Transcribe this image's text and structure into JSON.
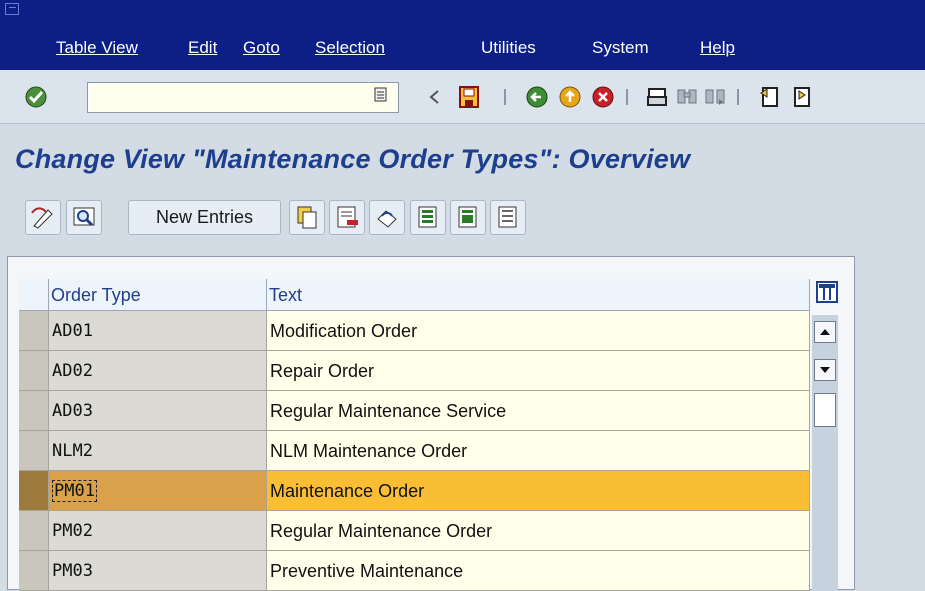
{
  "menubar": {
    "items": [
      "Table View",
      "Edit",
      "Goto",
      "Selection",
      "Utilities",
      "System",
      "Help"
    ]
  },
  "toolbar": {
    "command_field_value": "",
    "icons": [
      "enter-icon",
      "back-arrow-icon",
      "save-icon",
      "back-icon",
      "exit-icon",
      "cancel-icon",
      "print-icon",
      "find-icon",
      "find-next-icon",
      "first-page-icon",
      "previous-page-icon"
    ]
  },
  "page": {
    "title": "Change View \"Maintenance Order Types\": Overview"
  },
  "app_toolbar": {
    "new_entries_label": "New Entries",
    "icons": [
      "display-change-icon",
      "details-icon",
      "copy-as-icon",
      "delete-icon",
      "undo-change-icon",
      "select-all-icon",
      "select-block-icon",
      "deselect-all-icon"
    ]
  },
  "table": {
    "columns": [
      "Order Type",
      "Text"
    ],
    "rows": [
      {
        "order_type": "AD01",
        "text": "Modification Order"
      },
      {
        "order_type": "AD02",
        "text": "Repair Order"
      },
      {
        "order_type": "AD03",
        "text": "Regular Maintenance Service"
      },
      {
        "order_type": "NLM2",
        "text": "NLM Maintenance Order"
      },
      {
        "order_type": "PM01",
        "text": "Maintenance Order"
      },
      {
        "order_type": "PM02",
        "text": "Regular Maintenance Order"
      },
      {
        "order_type": "PM03",
        "text": "Preventive Maintenance"
      }
    ],
    "selected_row": 4
  },
  "colors": {
    "menubar_bg": "#0b1f86",
    "title": "#1d3f8e",
    "selected_row": "#f9be34",
    "input_bg": "#ffffea"
  }
}
